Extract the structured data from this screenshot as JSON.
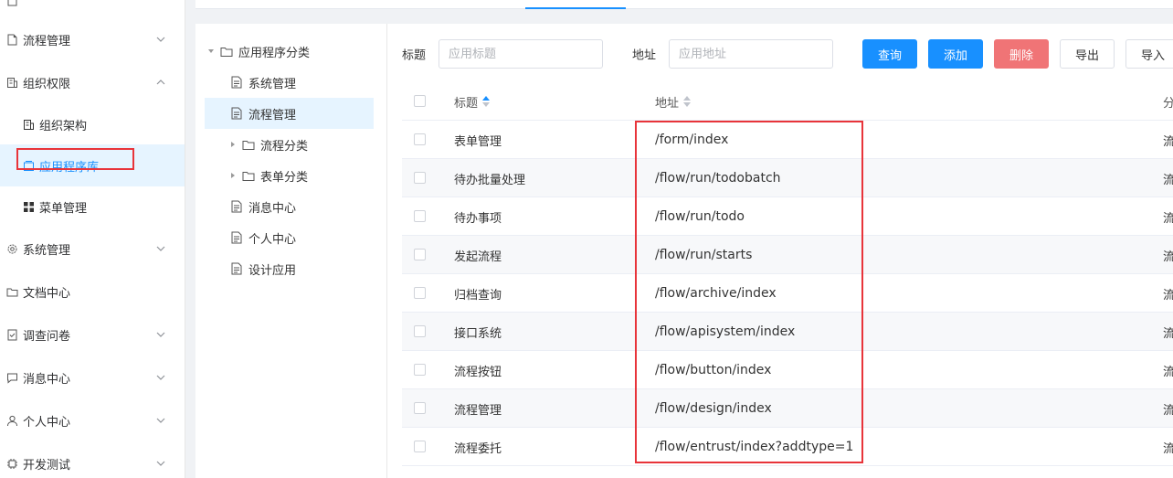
{
  "sidebar": {
    "items": [
      {
        "label": "流程管理",
        "icon": "file-icon",
        "expandable": true,
        "expanded": false
      },
      {
        "label": "组织权限",
        "icon": "org-icon",
        "expandable": true,
        "expanded": true
      },
      {
        "label": "组织架构",
        "icon": "building-icon",
        "sub": true
      },
      {
        "label": "应用程序库",
        "icon": "app-icon",
        "sub": true,
        "active": true
      },
      {
        "label": "菜单管理",
        "icon": "grid-icon",
        "sub": true
      },
      {
        "label": "系统管理",
        "icon": "gear-icon",
        "expandable": true,
        "expanded": false
      },
      {
        "label": "文档中心",
        "icon": "folder-icon",
        "expandable": false
      },
      {
        "label": "调查问卷",
        "icon": "survey-icon",
        "expandable": true,
        "expanded": false
      },
      {
        "label": "消息中心",
        "icon": "message-icon",
        "expandable": true,
        "expanded": false
      },
      {
        "label": "个人中心",
        "icon": "user-icon",
        "expandable": true,
        "expanded": false
      },
      {
        "label": "开发测试",
        "icon": "chip-icon",
        "expandable": true,
        "expanded": false
      }
    ]
  },
  "tree": {
    "root": "应用程序分类",
    "nodes": [
      {
        "label": "系统管理",
        "type": "doc"
      },
      {
        "label": "流程管理",
        "type": "doc",
        "selected": true
      },
      {
        "label": "流程分类",
        "type": "folder"
      },
      {
        "label": "表单分类",
        "type": "folder"
      },
      {
        "label": "消息中心",
        "type": "doc"
      },
      {
        "label": "个人中心",
        "type": "doc"
      },
      {
        "label": "设计应用",
        "type": "doc"
      }
    ]
  },
  "toolbar": {
    "title_label": "标题",
    "title_placeholder": "应用标题",
    "address_label": "地址",
    "address_placeholder": "应用地址",
    "query_label": "查询",
    "add_label": "添加",
    "delete_label": "删除",
    "export_label": "导出",
    "import_label": "导入"
  },
  "table": {
    "columns": {
      "title": "标题",
      "address": "地址",
      "category": "分"
    },
    "rows": [
      {
        "title": "表单管理",
        "address": "/form/index",
        "category": "流"
      },
      {
        "title": "待办批量处理",
        "address": "/flow/run/todobatch",
        "category": "流"
      },
      {
        "title": "待办事项",
        "address": "/flow/run/todo",
        "category": "流"
      },
      {
        "title": "发起流程",
        "address": "/flow/run/starts",
        "category": "流"
      },
      {
        "title": "归档查询",
        "address": "/flow/archive/index",
        "category": "流"
      },
      {
        "title": "接口系统",
        "address": "/flow/apisystem/index",
        "category": "流"
      },
      {
        "title": "流程按钮",
        "address": "/flow/button/index",
        "category": "流"
      },
      {
        "title": "流程管理",
        "address": "/flow/design/index",
        "category": "流"
      },
      {
        "title": "流程委托",
        "address": "/flow/entrust/index?addtype=1",
        "category": "流"
      }
    ]
  },
  "colors": {
    "primary": "#1890ff",
    "danger": "#f07476",
    "highlight": "#e8343a"
  }
}
